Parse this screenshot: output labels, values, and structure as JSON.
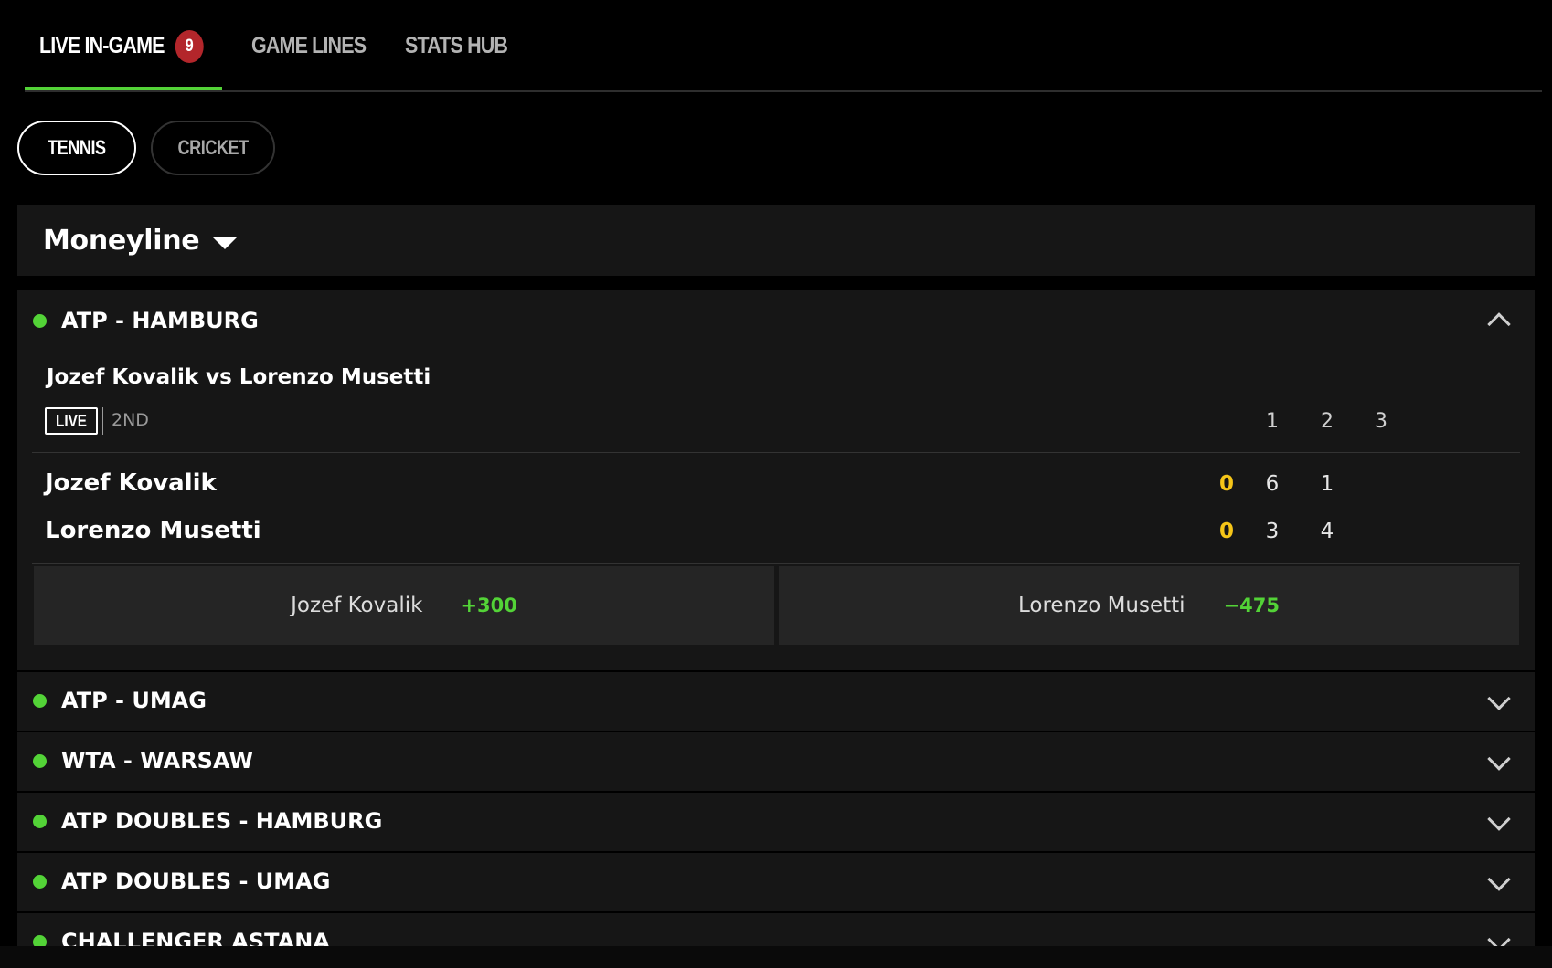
{
  "tabs": [
    {
      "label": "LIVE IN-GAME",
      "badge": "9"
    },
    {
      "label": "GAME LINES"
    },
    {
      "label": "STATS HUB"
    }
  ],
  "sports": [
    {
      "label": "TENNIS"
    },
    {
      "label": "CRICKET"
    }
  ],
  "market": {
    "label": "Moneyline"
  },
  "expanded_league": {
    "title": "ATP - HAMBURG",
    "match": {
      "title": "Jozef Kovalik vs Lorenzo Musetti",
      "status": "LIVE",
      "period": "2ND",
      "set_headers": [
        "1",
        "2",
        "3"
      ],
      "players": [
        {
          "name": "Jozef Kovalik",
          "game": "0",
          "sets": [
            "6",
            "1",
            ""
          ]
        },
        {
          "name": "Lorenzo Musetti",
          "game": "0",
          "sets": [
            "3",
            "4",
            ""
          ]
        }
      ],
      "odds": [
        {
          "name": "Jozef Kovalik",
          "price": "+300"
        },
        {
          "name": "Lorenzo Musetti",
          "price": "−475"
        }
      ]
    }
  },
  "leagues": [
    {
      "title": "ATP - UMAG"
    },
    {
      "title": "WTA - WARSAW"
    },
    {
      "title": "ATP DOUBLES - HAMBURG"
    },
    {
      "title": "ATP DOUBLES - UMAG"
    },
    {
      "title": "CHALLENGER ASTANA"
    }
  ],
  "colors": {
    "accent": "#53d337",
    "badge": "#b3262b",
    "game_score": "#f5c518"
  }
}
